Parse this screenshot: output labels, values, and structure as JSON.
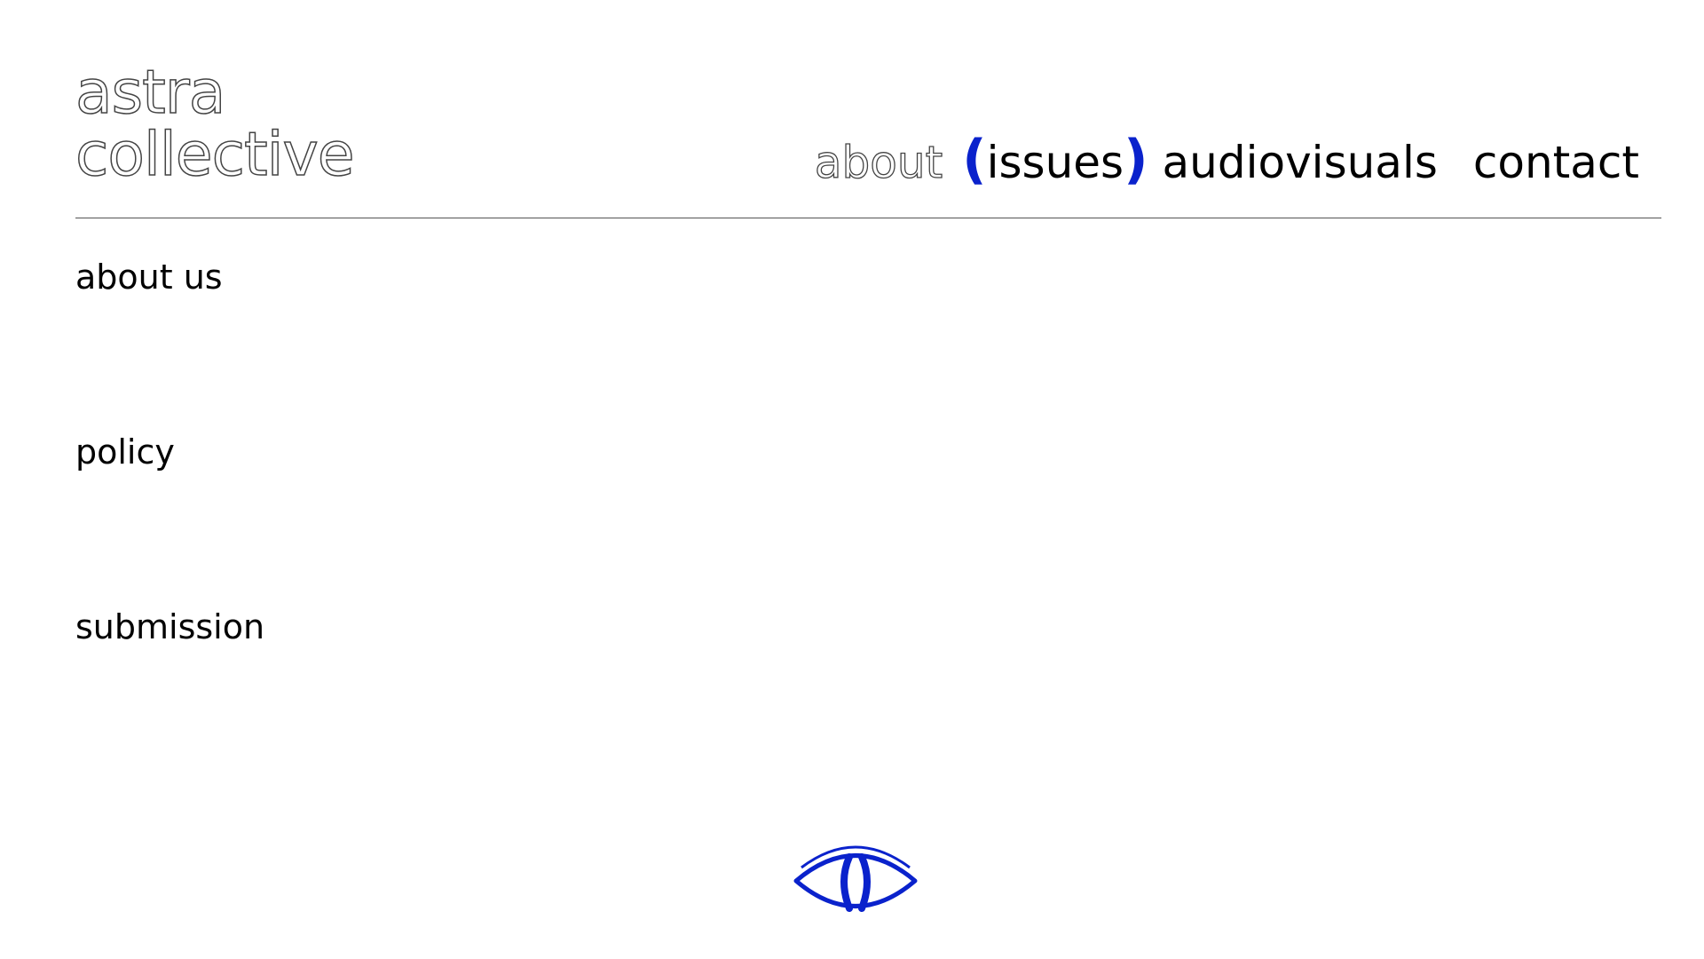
{
  "header": {
    "logo_line1": "astra",
    "logo_line2": "collective",
    "nav": {
      "about": "about",
      "issues_open": "(",
      "issues": "issues",
      "issues_close": ")",
      "audiovisuals": "audiovisuals",
      "contact": "contact"
    }
  },
  "sections": {
    "about_us": "about us",
    "policy": "policy",
    "submission": "submission"
  },
  "footer": {
    "icon": "eye-icon"
  },
  "colors": {
    "accent": "#0a22cc",
    "text": "#000000",
    "outline": "#444444",
    "divider": "#555555",
    "background": "#ffffff"
  }
}
